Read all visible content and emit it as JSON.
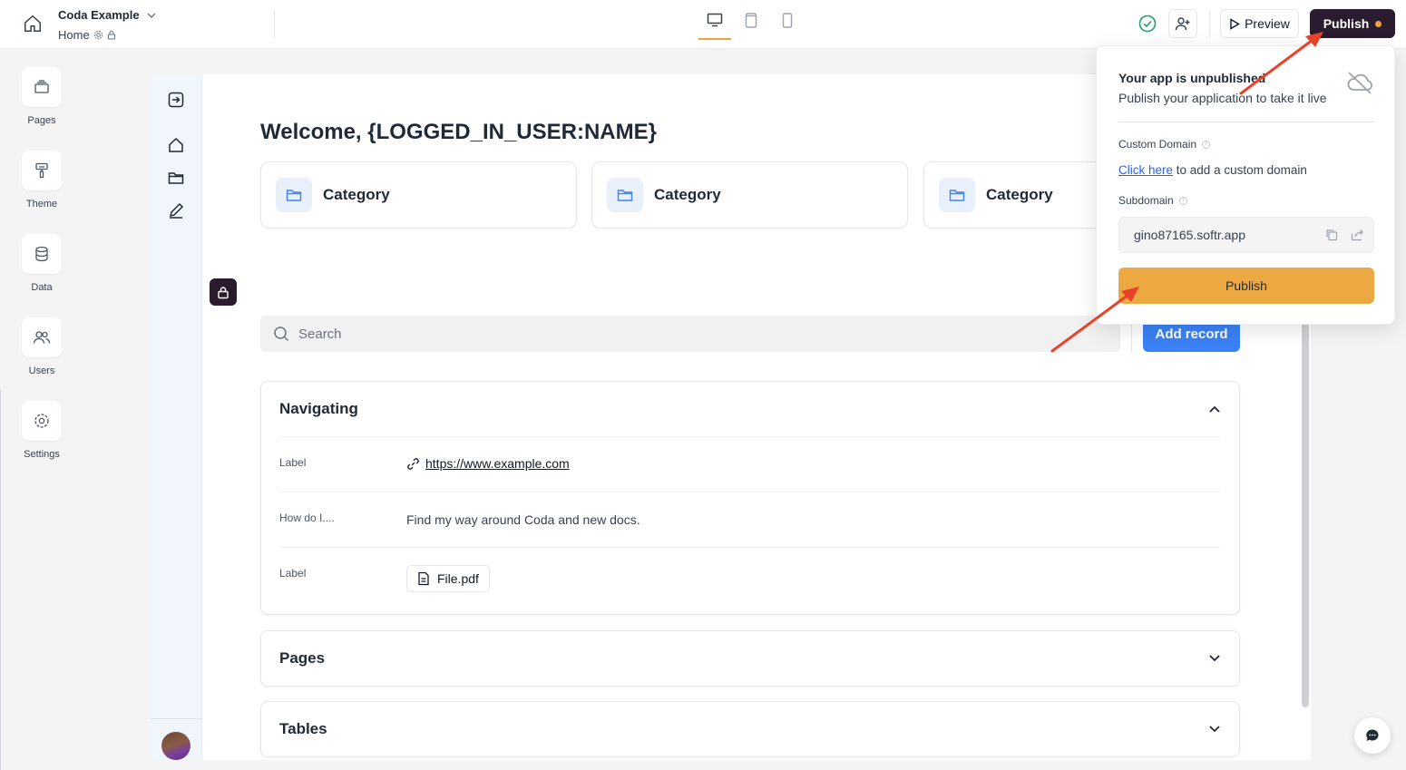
{
  "topbar": {
    "app_name": "Coda Example",
    "page_name": "Home",
    "preview_label": "Preview",
    "publish_label": "Publish"
  },
  "rail": {
    "items": [
      {
        "label": "Pages",
        "icon": "pages-icon"
      },
      {
        "label": "Theme",
        "icon": "paint-roller-icon"
      },
      {
        "label": "Data",
        "icon": "database-icon"
      },
      {
        "label": "Users",
        "icon": "users-icon"
      },
      {
        "label": "Settings",
        "icon": "gear-icon"
      }
    ]
  },
  "page": {
    "welcome": "Welcome, {LOGGED_IN_USER:NAME}",
    "categories": [
      "Category",
      "Category",
      "Category"
    ],
    "search_placeholder": "Search",
    "add_record_label": "Add record",
    "sections": {
      "navigating": {
        "title": "Navigating",
        "rows": [
          {
            "label": "Label",
            "value": "https://www.example.com"
          },
          {
            "label": "How do I....",
            "value": "Find my way around Coda and new docs."
          },
          {
            "label": "Label",
            "value": "File.pdf"
          }
        ]
      },
      "pages": {
        "title": "Pages"
      },
      "tables": {
        "title": "Tables"
      }
    }
  },
  "popover": {
    "title": "Your app is unpublished",
    "description": "Publish your application to take it live",
    "custom_domain_label": "Custom Domain",
    "custom_domain_link": "Click here",
    "custom_domain_text": " to add a custom domain",
    "subdomain_label": "Subdomain",
    "subdomain_value": "gino87165.softr.app",
    "publish_label": "Publish"
  },
  "colors": {
    "accent": "#eda941",
    "brand_dark": "#2a1b2e",
    "primary_blue": "#3b82f6",
    "annotation_arrow": "#e8432a"
  }
}
